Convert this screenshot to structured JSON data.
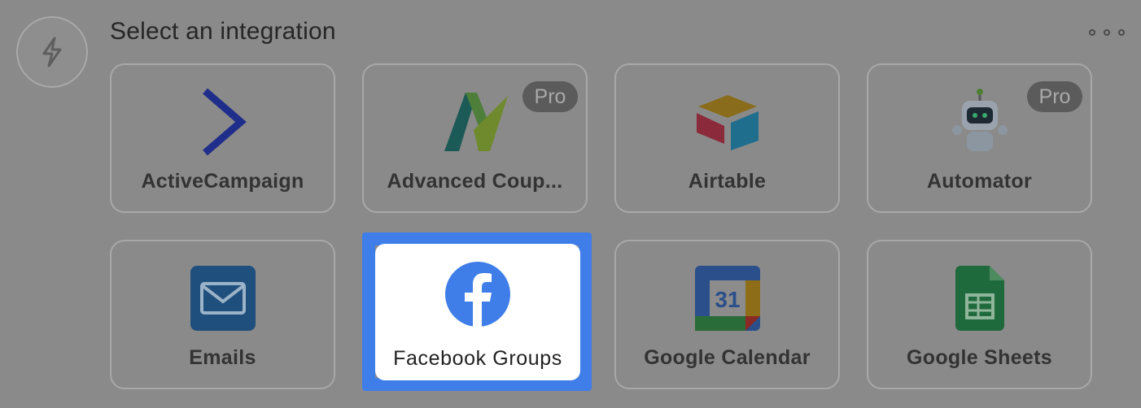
{
  "header": {
    "title": "Select an integration"
  },
  "icons": {
    "step": "lightning-bolt-icon",
    "more": "more-horizontal-icon"
  },
  "colors": {
    "selection_outline": "#3f7ee8",
    "overlay": "#8a8a8a"
  },
  "integrations": [
    {
      "name": "ActiveCampaign",
      "pro": false,
      "icon": "activecampaign-logo"
    },
    {
      "name": "Advanced Coup...",
      "pro": true,
      "badge": "Pro",
      "icon": "advanced-coupons-logo"
    },
    {
      "name": "Airtable",
      "pro": false,
      "icon": "airtable-logo"
    },
    {
      "name": "Automator",
      "pro": true,
      "badge": "Pro",
      "icon": "automator-robot-logo"
    },
    {
      "name": "Emails",
      "pro": false,
      "icon": "envelope-icon"
    },
    {
      "name": "Facebook Groups",
      "pro": false,
      "icon": "facebook-logo",
      "selected": true
    },
    {
      "name": "Google Calendar",
      "pro": false,
      "icon": "google-calendar-logo"
    },
    {
      "name": "Google Sheets",
      "pro": false,
      "icon": "google-sheets-logo"
    }
  ]
}
